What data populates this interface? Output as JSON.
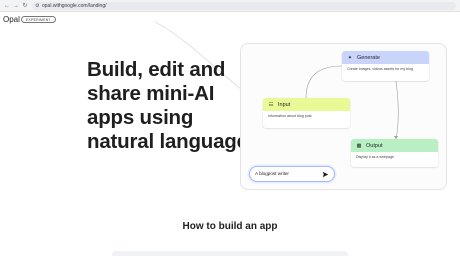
{
  "browser": {
    "back_icon": "back-arrow-icon",
    "forward_icon": "forward-arrow-icon",
    "reload_icon": "reload-icon",
    "site_info_icon": "site-info-icon",
    "url": "opal.withgoogle.com/landing/"
  },
  "header": {
    "brand": "Opal",
    "badge": "EXPERIMENT"
  },
  "hero": {
    "title_lines": [
      "Build, edit and",
      "share mini-AI",
      "apps using",
      "natural language"
    ]
  },
  "diagram": {
    "nodes": {
      "generate": {
        "title": "Generate",
        "icon": "sparkle-icon",
        "description": "Create images, videos assets for my blog",
        "color": "#c9d4fb"
      },
      "input": {
        "title": "Input",
        "icon": "input-icon",
        "description": "Information about blog post",
        "color": "#e9f995"
      },
      "output": {
        "title": "Output",
        "icon": "output-icon",
        "description": "Display it as a webpage",
        "color": "#b8f0c4"
      }
    },
    "prompt": {
      "text": "A blogpost writer",
      "icon": "send-icon"
    }
  },
  "section": {
    "heading": "How to build an app"
  },
  "colors": {
    "prompt_border": "#a8b8ff",
    "panel_border": "#e3e3e3"
  }
}
